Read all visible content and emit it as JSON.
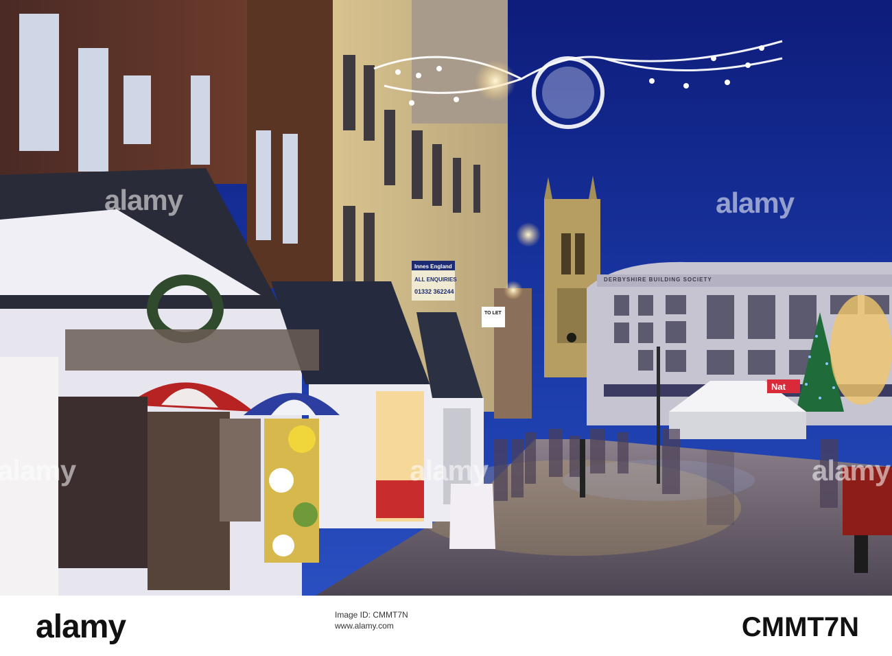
{
  "watermark": "alamy",
  "signs": {
    "society_banner": "DERBYSHIRE BUILDING SOCIETY",
    "agent_name": "Innes England",
    "agent_line": "ALL ENQUIRIES",
    "agent_phone": "01332 362244",
    "to_let": "TO LET",
    "shop_name": "Nat"
  },
  "footer": {
    "logo": "alamy",
    "meta_line1": "Image ID: CMMT7N",
    "meta_line2": "www.alamy.com",
    "image_id": "CMMT7N"
  }
}
